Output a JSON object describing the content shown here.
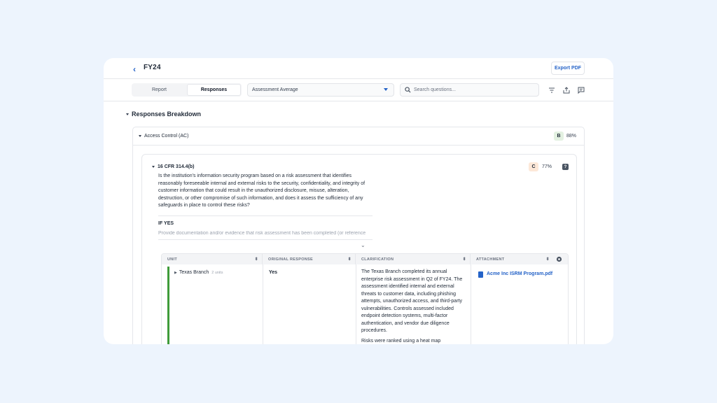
{
  "header": {
    "back_icon": "chevron-left-icon",
    "title": "FY24",
    "export_label": "Export PDF"
  },
  "toolbar": {
    "tabs": [
      {
        "label": "Report",
        "active": false
      },
      {
        "label": "Responses",
        "active": true
      }
    ],
    "select_value": "Assessment Average",
    "search_placeholder": "Search questions...",
    "icons": [
      "filter-icon",
      "share-icon",
      "comment-icon"
    ]
  },
  "section": {
    "title": "Responses Breakdown"
  },
  "category": {
    "title": "Access Control (AC)",
    "grade": "B",
    "percent": "88%",
    "grade_color": "#e3f1e1"
  },
  "question": {
    "code": "16 CFR 314.4(b)",
    "grade": "C",
    "percent": "77%",
    "grade_color": "#fde8d8",
    "text": "Is the institution's information security program based on a risk assessment that identifies reasonably foreseeable internal and external risks to the security, confidentiality, and integrity of customer information that could result in the unauthorized disclosure, misuse, alteration, destruction, or other compromise of such information, and does it assess the sufficiency of any safeguards in place to control these risks?",
    "if_yes_label": "IF YES",
    "if_yes_text": "Provide documentation and/or evidence that risk assessment has been completed (or reference"
  },
  "table": {
    "columns": [
      "UNIT",
      "ORIGINAL RESPONSE",
      "CLARIFICATION",
      "ATTACHMENT"
    ],
    "rows": [
      {
        "unit": "Texas Branch",
        "unit_meta": "2 units",
        "response": "Yes",
        "clarification_1": "The Texas Branch completed its annual enterprise risk assessment in Q2 of FY24. The assessment identified internal and external threats to customer data, including phishing attempts, unauthorized access, and third-party vulnerabilities. Controls assessed included endpoint detection systems, multi-factor authentication, and vendor due diligence procedures.",
        "clarification_2": "Risks were ranked using a heat map",
        "attachment": "Acme Inc ISRM Program.pdf"
      }
    ]
  }
}
